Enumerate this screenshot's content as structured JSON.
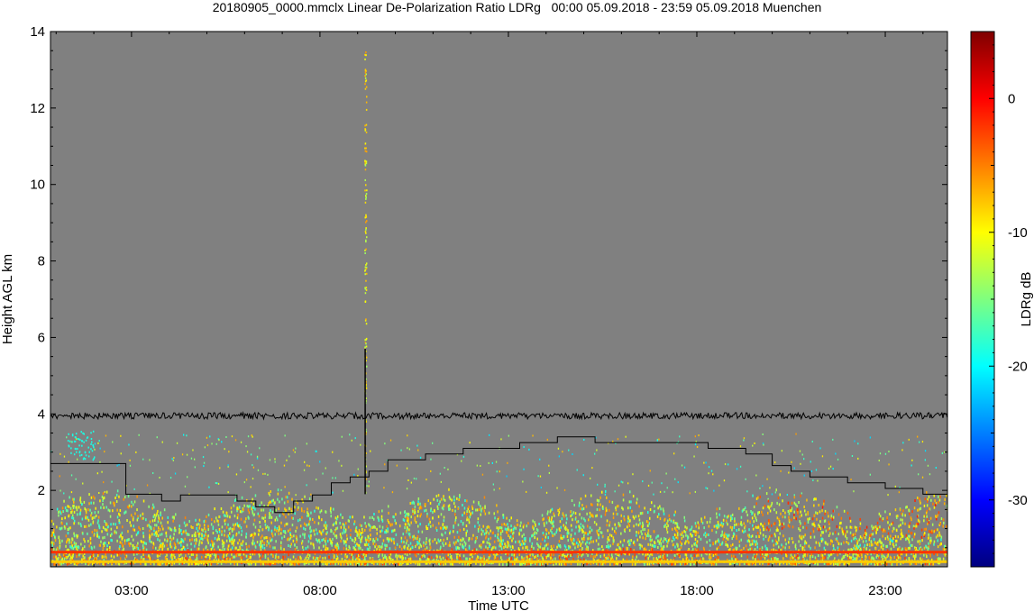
{
  "chart_data": {
    "type": "heatmap",
    "title": "20180905_0000.mmclx Linear De-Polarization Ratio LDRg   00:00 05.09.2018 - 23:59 05.09.2018 Muenchen",
    "xlabel": "Time UTC",
    "ylabel": "Height AGL km",
    "colorbar_label": "LDRg dB",
    "x_range_hours": [
      0.85,
      24.65
    ],
    "ylim_km": [
      0,
      14
    ],
    "x_tick_labels": [
      {
        "hour": 3,
        "label": "03:00"
      },
      {
        "hour": 8,
        "label": "08:00"
      },
      {
        "hour": 13,
        "label": "13:00"
      },
      {
        "hour": 18,
        "label": "18:00"
      },
      {
        "hour": 23,
        "label": "23:00"
      }
    ],
    "y_ticks": [
      2,
      4,
      6,
      8,
      10,
      12,
      14
    ],
    "colorbar_range_db": [
      -35,
      5
    ],
    "colorbar_ticks": [
      0,
      -10,
      -20,
      -30
    ],
    "colormap": [
      "#00007f",
      "#0000ff",
      "#007fff",
      "#00ffff",
      "#7fff7f",
      "#ffff00",
      "#ff7f00",
      "#ff0000",
      "#7f0000"
    ],
    "background_color": "#808080",
    "noise_line_height_km": 3.95,
    "spike": {
      "hour": 9.2,
      "from_km": 1.9,
      "to_km": 5.7,
      "scatter_top_km": 13.5
    },
    "boundary_layer_line": [
      {
        "h": 0.85,
        "km": 2.7
      },
      {
        "h": 2.85,
        "km": 2.7
      },
      {
        "h": 2.85,
        "km": 1.9
      },
      {
        "h": 3.8,
        "km": 1.9
      },
      {
        "h": 3.8,
        "km": 1.72
      },
      {
        "h": 4.3,
        "km": 1.72
      },
      {
        "h": 4.3,
        "km": 1.88
      },
      {
        "h": 5.8,
        "km": 1.88
      },
      {
        "h": 5.8,
        "km": 1.72
      },
      {
        "h": 6.3,
        "km": 1.72
      },
      {
        "h": 6.3,
        "km": 1.57
      },
      {
        "h": 6.8,
        "km": 1.57
      },
      {
        "h": 6.8,
        "km": 1.42
      },
      {
        "h": 7.3,
        "km": 1.42
      },
      {
        "h": 7.3,
        "km": 1.72
      },
      {
        "h": 7.8,
        "km": 1.72
      },
      {
        "h": 7.8,
        "km": 1.88
      },
      {
        "h": 8.3,
        "km": 1.88
      },
      {
        "h": 8.3,
        "km": 2.2
      },
      {
        "h": 8.8,
        "km": 2.2
      },
      {
        "h": 8.8,
        "km": 2.35
      },
      {
        "h": 9.3,
        "km": 2.35
      },
      {
        "h": 9.3,
        "km": 2.5
      },
      {
        "h": 9.8,
        "km": 2.5
      },
      {
        "h": 9.8,
        "km": 2.8
      },
      {
        "h": 10.8,
        "km": 2.8
      },
      {
        "h": 10.8,
        "km": 2.95
      },
      {
        "h": 11.8,
        "km": 2.95
      },
      {
        "h": 11.8,
        "km": 3.1
      },
      {
        "h": 13.3,
        "km": 3.1
      },
      {
        "h": 13.3,
        "km": 3.25
      },
      {
        "h": 14.3,
        "km": 3.25
      },
      {
        "h": 14.3,
        "km": 3.4
      },
      {
        "h": 15.3,
        "km": 3.4
      },
      {
        "h": 15.3,
        "km": 3.25
      },
      {
        "h": 18.3,
        "km": 3.25
      },
      {
        "h": 18.3,
        "km": 3.1
      },
      {
        "h": 19.3,
        "km": 3.1
      },
      {
        "h": 19.3,
        "km": 2.95
      },
      {
        "h": 20.0,
        "km": 2.95
      },
      {
        "h": 20.0,
        "km": 2.65
      },
      {
        "h": 20.5,
        "km": 2.65
      },
      {
        "h": 20.5,
        "km": 2.5
      },
      {
        "h": 21.0,
        "km": 2.5
      },
      {
        "h": 21.0,
        "km": 2.35
      },
      {
        "h": 22.0,
        "km": 2.35
      },
      {
        "h": 22.0,
        "km": 2.2
      },
      {
        "h": 23.0,
        "km": 2.2
      },
      {
        "h": 23.0,
        "km": 2.05
      },
      {
        "h": 24.0,
        "km": 2.05
      },
      {
        "h": 24.0,
        "km": 1.9
      },
      {
        "h": 24.65,
        "km": 1.9
      }
    ],
    "near_surface_band": {
      "from_km": 0.1,
      "to_km": 1.9,
      "typical_db": -12
    }
  }
}
